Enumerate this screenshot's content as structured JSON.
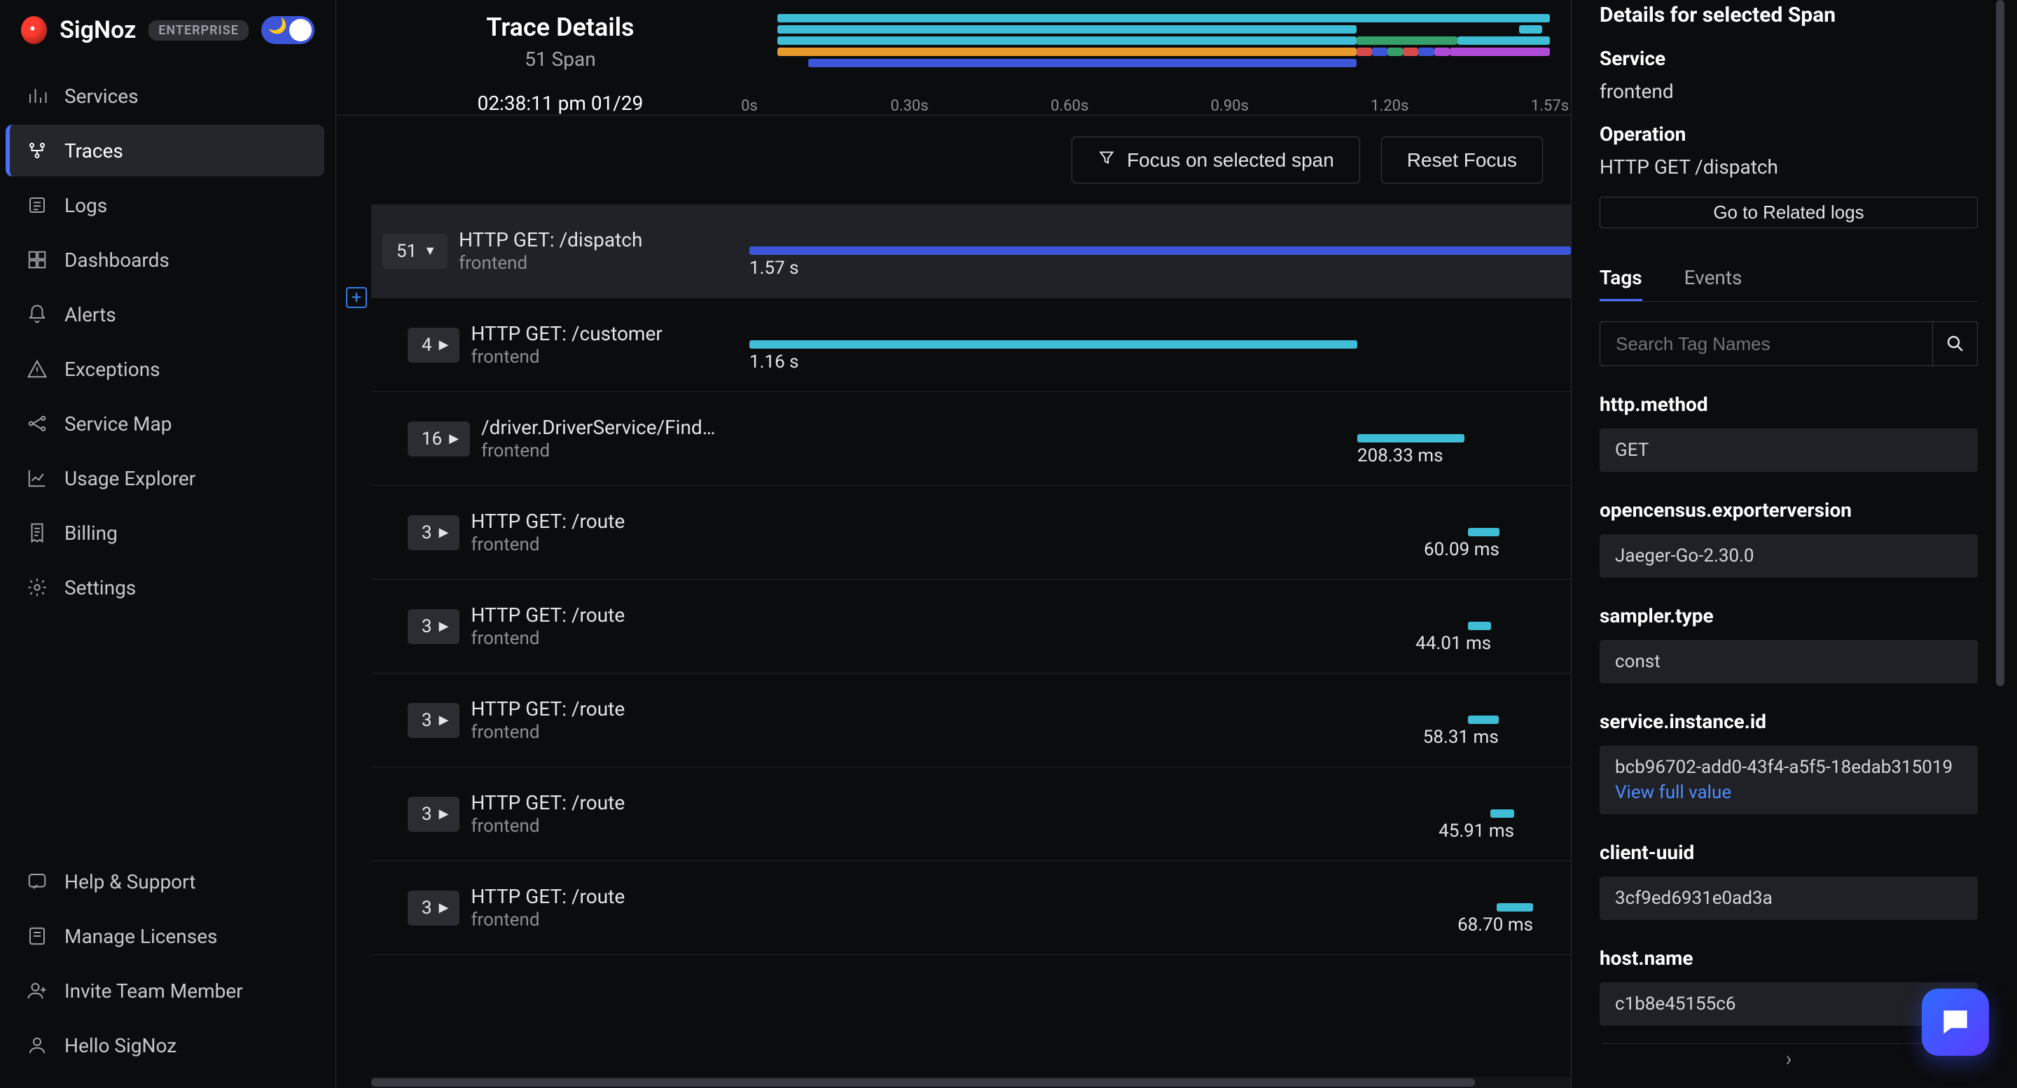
{
  "brand": {
    "name": "SigNoz",
    "badge": "ENTERPRISE"
  },
  "nav": {
    "items": [
      {
        "label": "Services"
      },
      {
        "label": "Traces"
      },
      {
        "label": "Logs"
      },
      {
        "label": "Dashboards"
      },
      {
        "label": "Alerts"
      },
      {
        "label": "Exceptions"
      },
      {
        "label": "Service Map"
      },
      {
        "label": "Usage Explorer"
      },
      {
        "label": "Billing"
      },
      {
        "label": "Settings"
      }
    ],
    "bottom": [
      {
        "label": "Help & Support"
      },
      {
        "label": "Manage Licenses"
      },
      {
        "label": "Invite Team Member"
      },
      {
        "label": "Hello SigNoz"
      }
    ]
  },
  "trace": {
    "title": "Trace Details",
    "span_count": "51 Span",
    "timestamp": "02:38:11 pm 01/29",
    "ruler": [
      "0s",
      "0.30s",
      "0.60s",
      "0.90s",
      "1.20s",
      "1.57s"
    ]
  },
  "controls": {
    "focus_selected": "Focus on selected span",
    "reset_focus": "Reset Focus"
  },
  "spans": [
    {
      "count": "51",
      "caret": "▼",
      "indent": 0,
      "name": "HTTP GET: /dispatch",
      "service": "frontend",
      "bar": {
        "left_pct": 0,
        "width_pct": 100,
        "color": "#3d55d8"
      },
      "dur": "1.57 s",
      "dur_side": "left",
      "selected": true
    },
    {
      "count": "4",
      "caret": "▶",
      "indent": 1,
      "name": "HTTP GET: /customer",
      "service": "frontend",
      "bar": {
        "left_pct": 0,
        "width_pct": 74,
        "color": "#3fbcd6"
      },
      "dur": "1.16 s",
      "dur_side": "left"
    },
    {
      "count": "16",
      "caret": "▶",
      "indent": 1,
      "name": "/driver.DriverService/Find…",
      "service": "frontend",
      "bar": {
        "left_pct": 74,
        "width_pct": 13,
        "color": "#3fbcd6"
      },
      "dur": "208.33 ms",
      "dur_side": "left"
    },
    {
      "count": "3",
      "caret": "▶",
      "indent": 1,
      "name": "HTTP GET: /route",
      "service": "frontend",
      "bar": {
        "left_pct": 87.5,
        "width_pct": 3.8,
        "color": "#3fbcd6"
      },
      "dur": "60.09 ms",
      "dur_side": "right"
    },
    {
      "count": "3",
      "caret": "▶",
      "indent": 1,
      "name": "HTTP GET: /route",
      "service": "frontend",
      "bar": {
        "left_pct": 87.5,
        "width_pct": 2.8,
        "color": "#3fbcd6"
      },
      "dur": "44.01 ms",
      "dur_side": "right"
    },
    {
      "count": "3",
      "caret": "▶",
      "indent": 1,
      "name": "HTTP GET: /route",
      "service": "frontend",
      "bar": {
        "left_pct": 87.5,
        "width_pct": 3.7,
        "color": "#3fbcd6"
      },
      "dur": "58.31 ms",
      "dur_side": "right"
    },
    {
      "count": "3",
      "caret": "▶",
      "indent": 1,
      "name": "HTTP GET: /route",
      "service": "frontend",
      "bar": {
        "left_pct": 90.2,
        "width_pct": 2.9,
        "color": "#3fbcd6"
      },
      "dur": "45.91 ms",
      "dur_side": "right"
    },
    {
      "count": "3",
      "caret": "▶",
      "indent": 1,
      "name": "HTTP GET: /route",
      "service": "frontend",
      "bar": {
        "left_pct": 91.0,
        "width_pct": 4.4,
        "color": "#3fbcd6"
      },
      "dur": "68.70 ms",
      "dur_side": "right"
    }
  ],
  "details": {
    "title": "Details for selected Span",
    "service_label": "Service",
    "service_value": "frontend",
    "operation_label": "Operation",
    "operation_value": "HTTP GET /dispatch",
    "related_logs": "Go to Related logs",
    "tabs": {
      "tags": "Tags",
      "events": "Events"
    },
    "search_placeholder": "Search Tag Names",
    "tags": [
      {
        "name": "http.method",
        "value": "GET"
      },
      {
        "name": "opencensus.exporterversion",
        "value": "Jaeger-Go-2.30.0"
      },
      {
        "name": "sampler.type",
        "value": "const"
      },
      {
        "name": "service.instance.id",
        "value": "bcb96702-add0-43f4-a5f5-18edab315019",
        "link": "View full value"
      },
      {
        "name": "client-uuid",
        "value": "3cf9ed6931e0ad3a"
      },
      {
        "name": "host.name",
        "value": "c1b8e45155c6"
      }
    ]
  },
  "mini_timeline": [
    [
      {
        "l": 0,
        "w": 100,
        "c": "#3fbcd6"
      }
    ],
    [
      {
        "l": 0,
        "w": 75,
        "c": "#3fbcd6"
      },
      {
        "l": 96,
        "w": 3,
        "c": "#3fbcd6"
      }
    ],
    [
      {
        "l": 0,
        "w": 75,
        "c": "#3fbcd6"
      },
      {
        "l": 75,
        "w": 13,
        "c": "#37a06a"
      },
      {
        "l": 88,
        "w": 12,
        "c": "#3fbcd6"
      }
    ],
    [
      {
        "l": 0,
        "w": 75,
        "c": "#e79b2c"
      },
      {
        "l": 75,
        "w": 2,
        "c": "#d84b4b"
      },
      {
        "l": 77,
        "w": 2,
        "c": "#3d55d8"
      },
      {
        "l": 79,
        "w": 2,
        "c": "#37a06a"
      },
      {
        "l": 81,
        "w": 2,
        "c": "#d84b4b"
      },
      {
        "l": 83,
        "w": 2,
        "c": "#3d55d8"
      },
      {
        "l": 85,
        "w": 2,
        "c": "#b04bd8"
      },
      {
        "l": 87,
        "w": 13,
        "c": "#b04bd8"
      }
    ],
    [
      {
        "l": 4,
        "w": 71,
        "c": "#3d55d8"
      }
    ]
  ]
}
